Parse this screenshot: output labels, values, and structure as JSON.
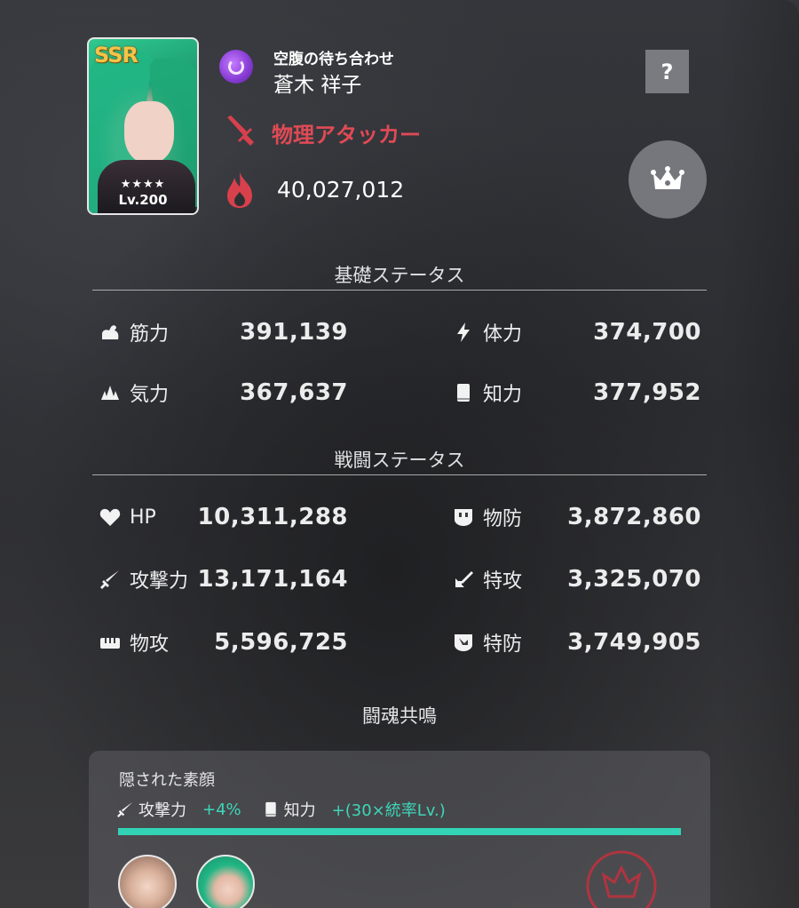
{
  "character": {
    "rarity": "SSR",
    "stars": "★★★★",
    "level": "Lv.200",
    "unit_name": "空腹の待ち合わせ",
    "name": "蒼木 祥子",
    "role": "物理アタッカー",
    "power": "40,027,012",
    "attribute_icon": "purple-attribute-icon",
    "role_color": "#e04a55"
  },
  "buttons": {
    "help_label": "?",
    "crown_icon": "crown-icon"
  },
  "basic_status": {
    "title": "基礎ステータス",
    "stats": [
      {
        "icon": "muscle-icon",
        "label": "筋力",
        "value": "391,139"
      },
      {
        "icon": "lightning-icon",
        "label": "体力",
        "value": "374,700"
      },
      {
        "icon": "spirit-icon",
        "label": "気力",
        "value": "367,637"
      },
      {
        "icon": "book-icon",
        "label": "知力",
        "value": "377,952"
      }
    ]
  },
  "battle_status": {
    "title": "戦闘ステータス",
    "stats": [
      {
        "icon": "heart-icon",
        "label": "HP",
        "value": "10,311,288"
      },
      {
        "icon": "shield-icon",
        "label": "物防",
        "value": "3,872,860"
      },
      {
        "icon": "sword-icon",
        "label": "攻撃力",
        "value": "13,171,164"
      },
      {
        "icon": "arrow-icon",
        "label": "特攻",
        "value": "3,325,070"
      },
      {
        "icon": "fist-icon",
        "label": "物攻",
        "value": "5,596,725"
      },
      {
        "icon": "special-shield-icon",
        "label": "特防",
        "value": "3,749,905"
      }
    ]
  },
  "resonance": {
    "title": "闘魂共鳴",
    "name": "隠された素顔",
    "effects": [
      {
        "icon": "sword-icon",
        "label": "攻撃力",
        "bonus": "+4%"
      },
      {
        "icon": "book-icon",
        "label": "知力",
        "bonus": "+(30×統率Lv.)"
      }
    ],
    "accent_color": "#33d4b6"
  }
}
